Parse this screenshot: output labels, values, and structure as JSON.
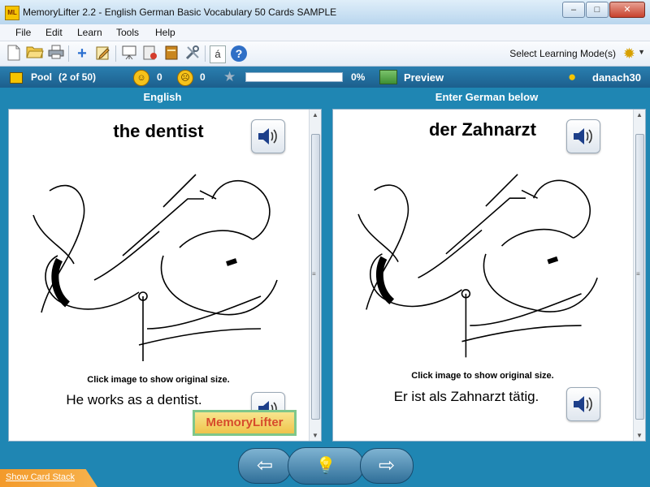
{
  "window": {
    "title": "MemoryLifter 2.2 - English German Basic Vocabulary 50 Cards SAMPLE",
    "app_icon_text": "ML",
    "minimize": "–",
    "maximize": "□",
    "close": "✕"
  },
  "menu": [
    "File",
    "Edit",
    "Learn",
    "Tools",
    "Help"
  ],
  "toolbar": {
    "icons": [
      "new-icon",
      "open-icon",
      "print-icon",
      "add-icon",
      "edit-icon",
      "presentation-icon",
      "cardset-icon",
      "book-icon",
      "settings-tools-icon",
      "character-map-icon",
      "help-icon"
    ],
    "char_btn": "á",
    "help_btn": "?",
    "mode_label": "Select Learning Mode(s)",
    "mode_icon": "gear-sun-icon"
  },
  "status": {
    "pool_label": "Pool",
    "pool_count": "(2 of 50)",
    "correct_count": "0",
    "wrong_count": "0",
    "progress_percent": 0,
    "progress_text": "0%",
    "preview_label": "Preview",
    "username": "danach30"
  },
  "left": {
    "header": "English",
    "word": "the dentist",
    "caption": "Click image to show original size.",
    "sentence": "He works as a dentist.",
    "logo_text": "MemoryLifter"
  },
  "right": {
    "header": "Enter German below",
    "word": "der Zahnarzt",
    "caption": "Click image to show original size.",
    "sentence": "Er ist als Zahnarzt tätig."
  },
  "navigation": {
    "back_icon": "arrow-left-icon",
    "hint_icon": "lightbulb-icon",
    "next_icon": "arrow-right-icon"
  },
  "footer": {
    "show_stack": "Show Card Stack"
  },
  "colors": {
    "background": "#1f86b3",
    "status_bar": "#1c5f8d",
    "progress_fill": "#3aa33a"
  }
}
